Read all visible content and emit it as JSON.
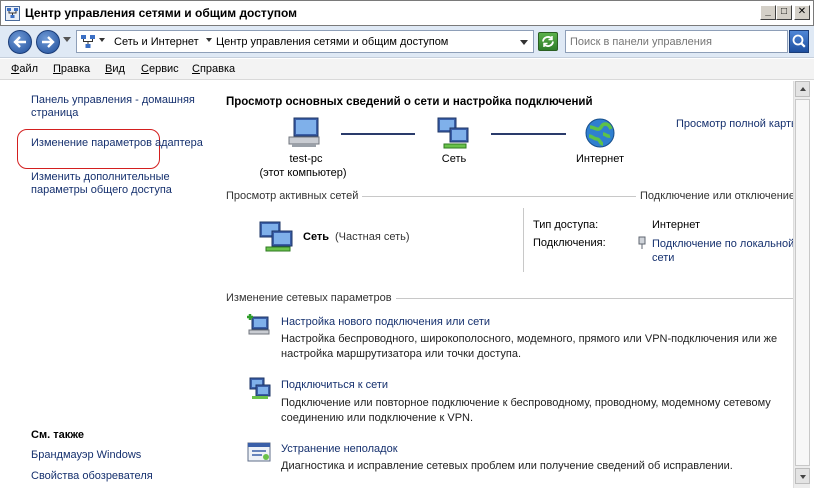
{
  "window": {
    "title": "Центр управления сетями и общим доступом",
    "min_label": "_",
    "max_label": "□",
    "close_label": "✕"
  },
  "address": {
    "crumbs": [
      "Сеть и Интернет",
      "Центр управления сетями и общим доступом"
    ],
    "search_placeholder": "Поиск в панели управления"
  },
  "menu": [
    {
      "mnemonic": "Ф",
      "rest": "айл"
    },
    {
      "mnemonic": "П",
      "rest": "равка"
    },
    {
      "mnemonic": "В",
      "rest": "ид"
    },
    {
      "mnemonic": "С",
      "rest": "ервис"
    },
    {
      "mnemonic": "С",
      "rest": "правка"
    }
  ],
  "sidebar": {
    "home": "Панель управления - домашняя страница",
    "adapter": "Изменение параметров адаптера",
    "sharing": "Изменить дополнительные параметры общего доступа",
    "see_also": "См. также",
    "firewall": "Брандмауэр Windows",
    "browser": "Свойства обозревателя"
  },
  "main": {
    "title": "Просмотр основных сведений о сети и настройка подключений",
    "full_map": "Просмотр полной карты",
    "nodes": {
      "computer": "test-pc",
      "computer_sub": "(этот компьютер)",
      "network": "Сеть",
      "internet": "Интернет"
    },
    "active_header": "Просмотр активных сетей",
    "connect_header": "Подключение или отключение",
    "network_name": "Сеть",
    "network_type": "(Частная сеть)",
    "access_type_label": "Тип доступа:",
    "access_type_value": "Интернет",
    "connections_label": "Подключения:",
    "connections_value": "Подключение по локальной сети",
    "change_header": "Изменение сетевых параметров",
    "tasks": [
      {
        "title": "Настройка нового подключения или сети",
        "desc": "Настройка беспроводного, широкополосного, модемного, прямого или VPN-подключения или же настройка маршрутизатора или точки доступа."
      },
      {
        "title": "Подключиться к сети",
        "desc": "Подключение или повторное подключение к беспроводному, проводному, модемному сетевому соединению или подключение к VPN."
      },
      {
        "title": "Устранение неполадок",
        "desc": "Диагностика и исправление сетевых проблем или получение сведений об исправлении."
      }
    ]
  },
  "colors": {
    "link": "#15306e",
    "highlight_circle": "#d31f1f"
  }
}
